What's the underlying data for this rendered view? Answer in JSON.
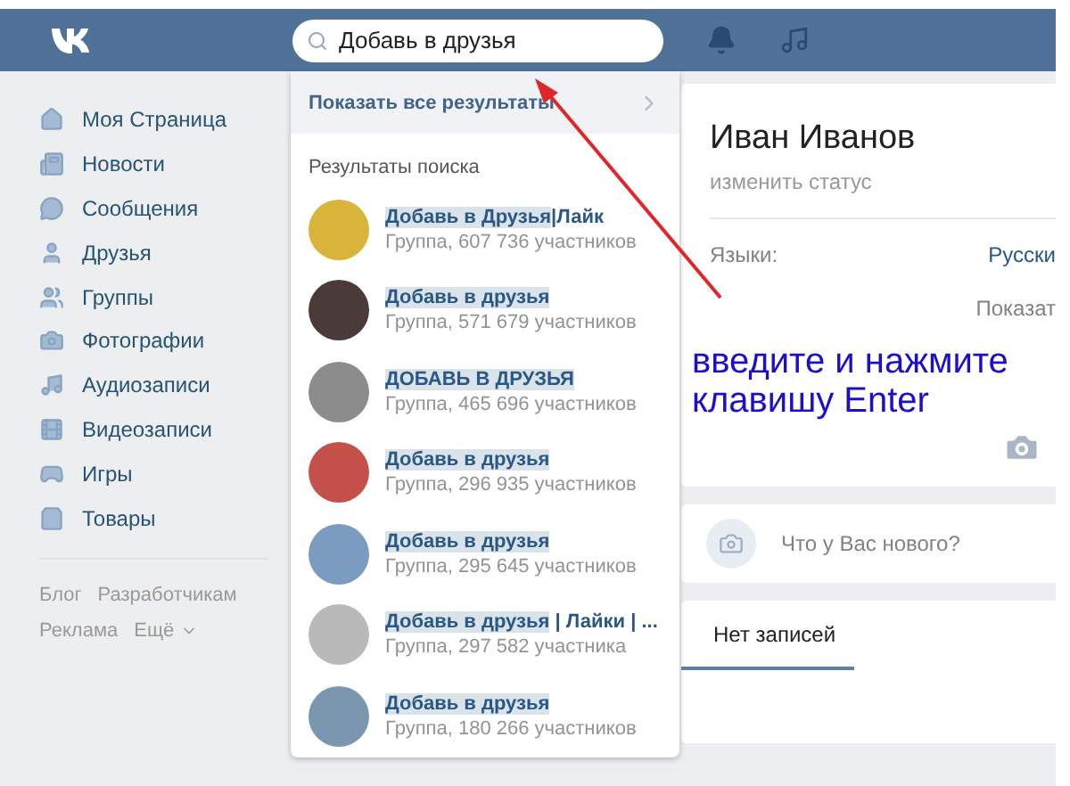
{
  "header": {
    "search_value": "Добавь в друзья"
  },
  "sidebar": {
    "items": [
      {
        "label": "Моя Страница"
      },
      {
        "label": "Новости"
      },
      {
        "label": "Сообщения"
      },
      {
        "label": "Друзья"
      },
      {
        "label": "Группы"
      },
      {
        "label": "Фотографии"
      },
      {
        "label": "Аудиозаписи"
      },
      {
        "label": "Видеозаписи"
      },
      {
        "label": "Игры"
      },
      {
        "label": "Товары"
      }
    ],
    "footer_links": [
      [
        "Блог",
        "Разработчикам"
      ],
      [
        "Реклама",
        "Ещё"
      ]
    ]
  },
  "search_dropdown": {
    "show_all": "Показать все результаты",
    "section_title": "Результаты поиска",
    "results": [
      {
        "match": "Добавь в Друзья",
        "rest": "|Лайк",
        "subtitle": "Группа, 607 736 участников"
      },
      {
        "match": "Добавь в друзья",
        "subtitle": "Группа, 571 679 участников"
      },
      {
        "match": "ДОБАВЬ В ДРУЗЬЯ",
        "subtitle": "Группа, 465 696 участников"
      },
      {
        "match": "Добавь в друзья",
        "subtitle": "Группа, 296 935 участников"
      },
      {
        "match": "Добавь в друзья",
        "subtitle": "Группа, 295 645 участников"
      },
      {
        "match": "Добавь в друзья",
        "rest": " | Лайки | ...",
        "subtitle": "Группа, 297 582 участника"
      },
      {
        "match": "Добавь в друзья",
        "subtitle": "Группа, 180 266 участников"
      }
    ]
  },
  "profile": {
    "name": "Иван Иванов",
    "status_action": "изменить статус",
    "info": [
      {
        "label": "Языки:",
        "value": "Русски"
      }
    ],
    "show_more": "Показат"
  },
  "composer": {
    "placeholder": "Что у Вас нового?"
  },
  "wall": {
    "tabs": [
      {
        "label": "Нет записей",
        "selected": true
      }
    ]
  },
  "annotation": {
    "lines": [
      "введите и нажмите",
      "клавишу Enter"
    ]
  }
}
